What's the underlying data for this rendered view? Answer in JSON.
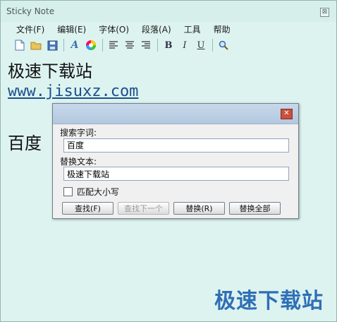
{
  "window": {
    "title": "Sticky Note",
    "close_glyph": "⊠"
  },
  "menu": [
    "文件(F)",
    "编辑(E)",
    "字体(O)",
    "段落(A)",
    "工具",
    "帮助"
  ],
  "toolbar": {
    "items": [
      "new-file-icon",
      "open-folder-icon",
      "save-icon",
      "font-icon",
      "color-icon",
      "align-left-icon",
      "align-center-icon",
      "align-right-icon",
      "bold-icon",
      "italic-icon",
      "underline-icon",
      "search-icon"
    ],
    "bold": "B",
    "italic": "I",
    "underline": "U",
    "font": "A"
  },
  "editor": {
    "line1": "极速下载站",
    "line2": "www.jisuxz.com",
    "line3": "百度"
  },
  "watermark": "极速下载站",
  "dialog": {
    "close_glyph": "✕",
    "search_label": "搜索字词:",
    "search_value": "百度",
    "replace_label": "替换文本:",
    "replace_value": "极速下载站",
    "match_case_label": "匹配大小写",
    "buttons": {
      "find": "查找(F)",
      "find_next": "查找下一个",
      "replace": "替换(R)",
      "replace_all": "替换全部"
    }
  }
}
